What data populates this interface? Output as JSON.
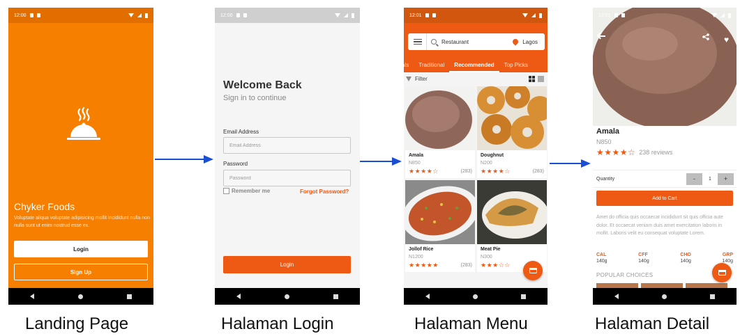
{
  "colors": {
    "landing_bg": "#f77f00",
    "accent": "#ee5a13",
    "arrow": "#1a4fd4",
    "status_dark": "#d2570e"
  },
  "captions": {
    "landing": "Landing Page",
    "login": "Halaman Login",
    "menu": "Halaman Menu",
    "detail": "Halaman Detail"
  },
  "landing": {
    "time": "12:00",
    "title": "Chyker Foods",
    "description": "Voluptate aliqua voluptate adipisicing mollit incididunt nulla non nulla sunt ut enim nostrud esse ex.",
    "login_label": "Login",
    "signup_label": "Sign Up",
    "logo_icon": "cloche-icon"
  },
  "login": {
    "time": "12:00",
    "title": "Welcome Back",
    "subtitle": "Sign in to continue",
    "email_label": "Email Address",
    "email_placeholder": "Email Address",
    "password_label": "Password",
    "password_placeholder": "Password",
    "remember_label": "Remember me",
    "forgot_label": "Forgot Password?",
    "login_label": "Login"
  },
  "menu": {
    "time": "12:01",
    "search_value": "Restaurant",
    "location": "Lagos",
    "tabs": [
      {
        "label": "als"
      },
      {
        "label": "Traditional"
      },
      {
        "label": "Recommended"
      },
      {
        "label": "Top Picks"
      }
    ],
    "active_tab": "Recommended",
    "filter_label": "Filter",
    "items": [
      {
        "name": "Amala",
        "price": "N850",
        "stars": "★★★★☆",
        "rating": 4,
        "count": "(283)"
      },
      {
        "name": "Doughnut",
        "price": "N200",
        "stars": "★★★★☆",
        "rating": 4,
        "count": "(283)"
      },
      {
        "name": "Jollof Rice",
        "price": "N1200",
        "stars": "★★★★★",
        "rating": 5,
        "count": "(283)"
      },
      {
        "name": "Meat Pie",
        "price": "N300",
        "stars": "★★★☆☆",
        "rating": 3,
        "count": ""
      }
    ]
  },
  "detail": {
    "time": "12:01",
    "name": "Amala",
    "price": "N850",
    "stars": "★★★★☆",
    "rating": 4,
    "reviews": "238 reviews",
    "quantity_label": "Quantity",
    "qty_minus": "-",
    "qty_value": "1",
    "qty_plus": "+",
    "add_to_cart": "Add to Cart",
    "description": "Amet do officia quis occaecat incididunt sit quis officia aute dolor. Et occaecat veniam duis amet exercitation laboris in mollit. Laboris velit eu consequat voluptate Lorem.",
    "nutrition": [
      {
        "label": "CAL",
        "value": "140g"
      },
      {
        "label": "CFF",
        "value": "140g"
      },
      {
        "label": "CHO",
        "value": "140g"
      },
      {
        "label": "GRP",
        "value": "140g"
      }
    ],
    "popular_title": "POPULAR CHOICES"
  }
}
